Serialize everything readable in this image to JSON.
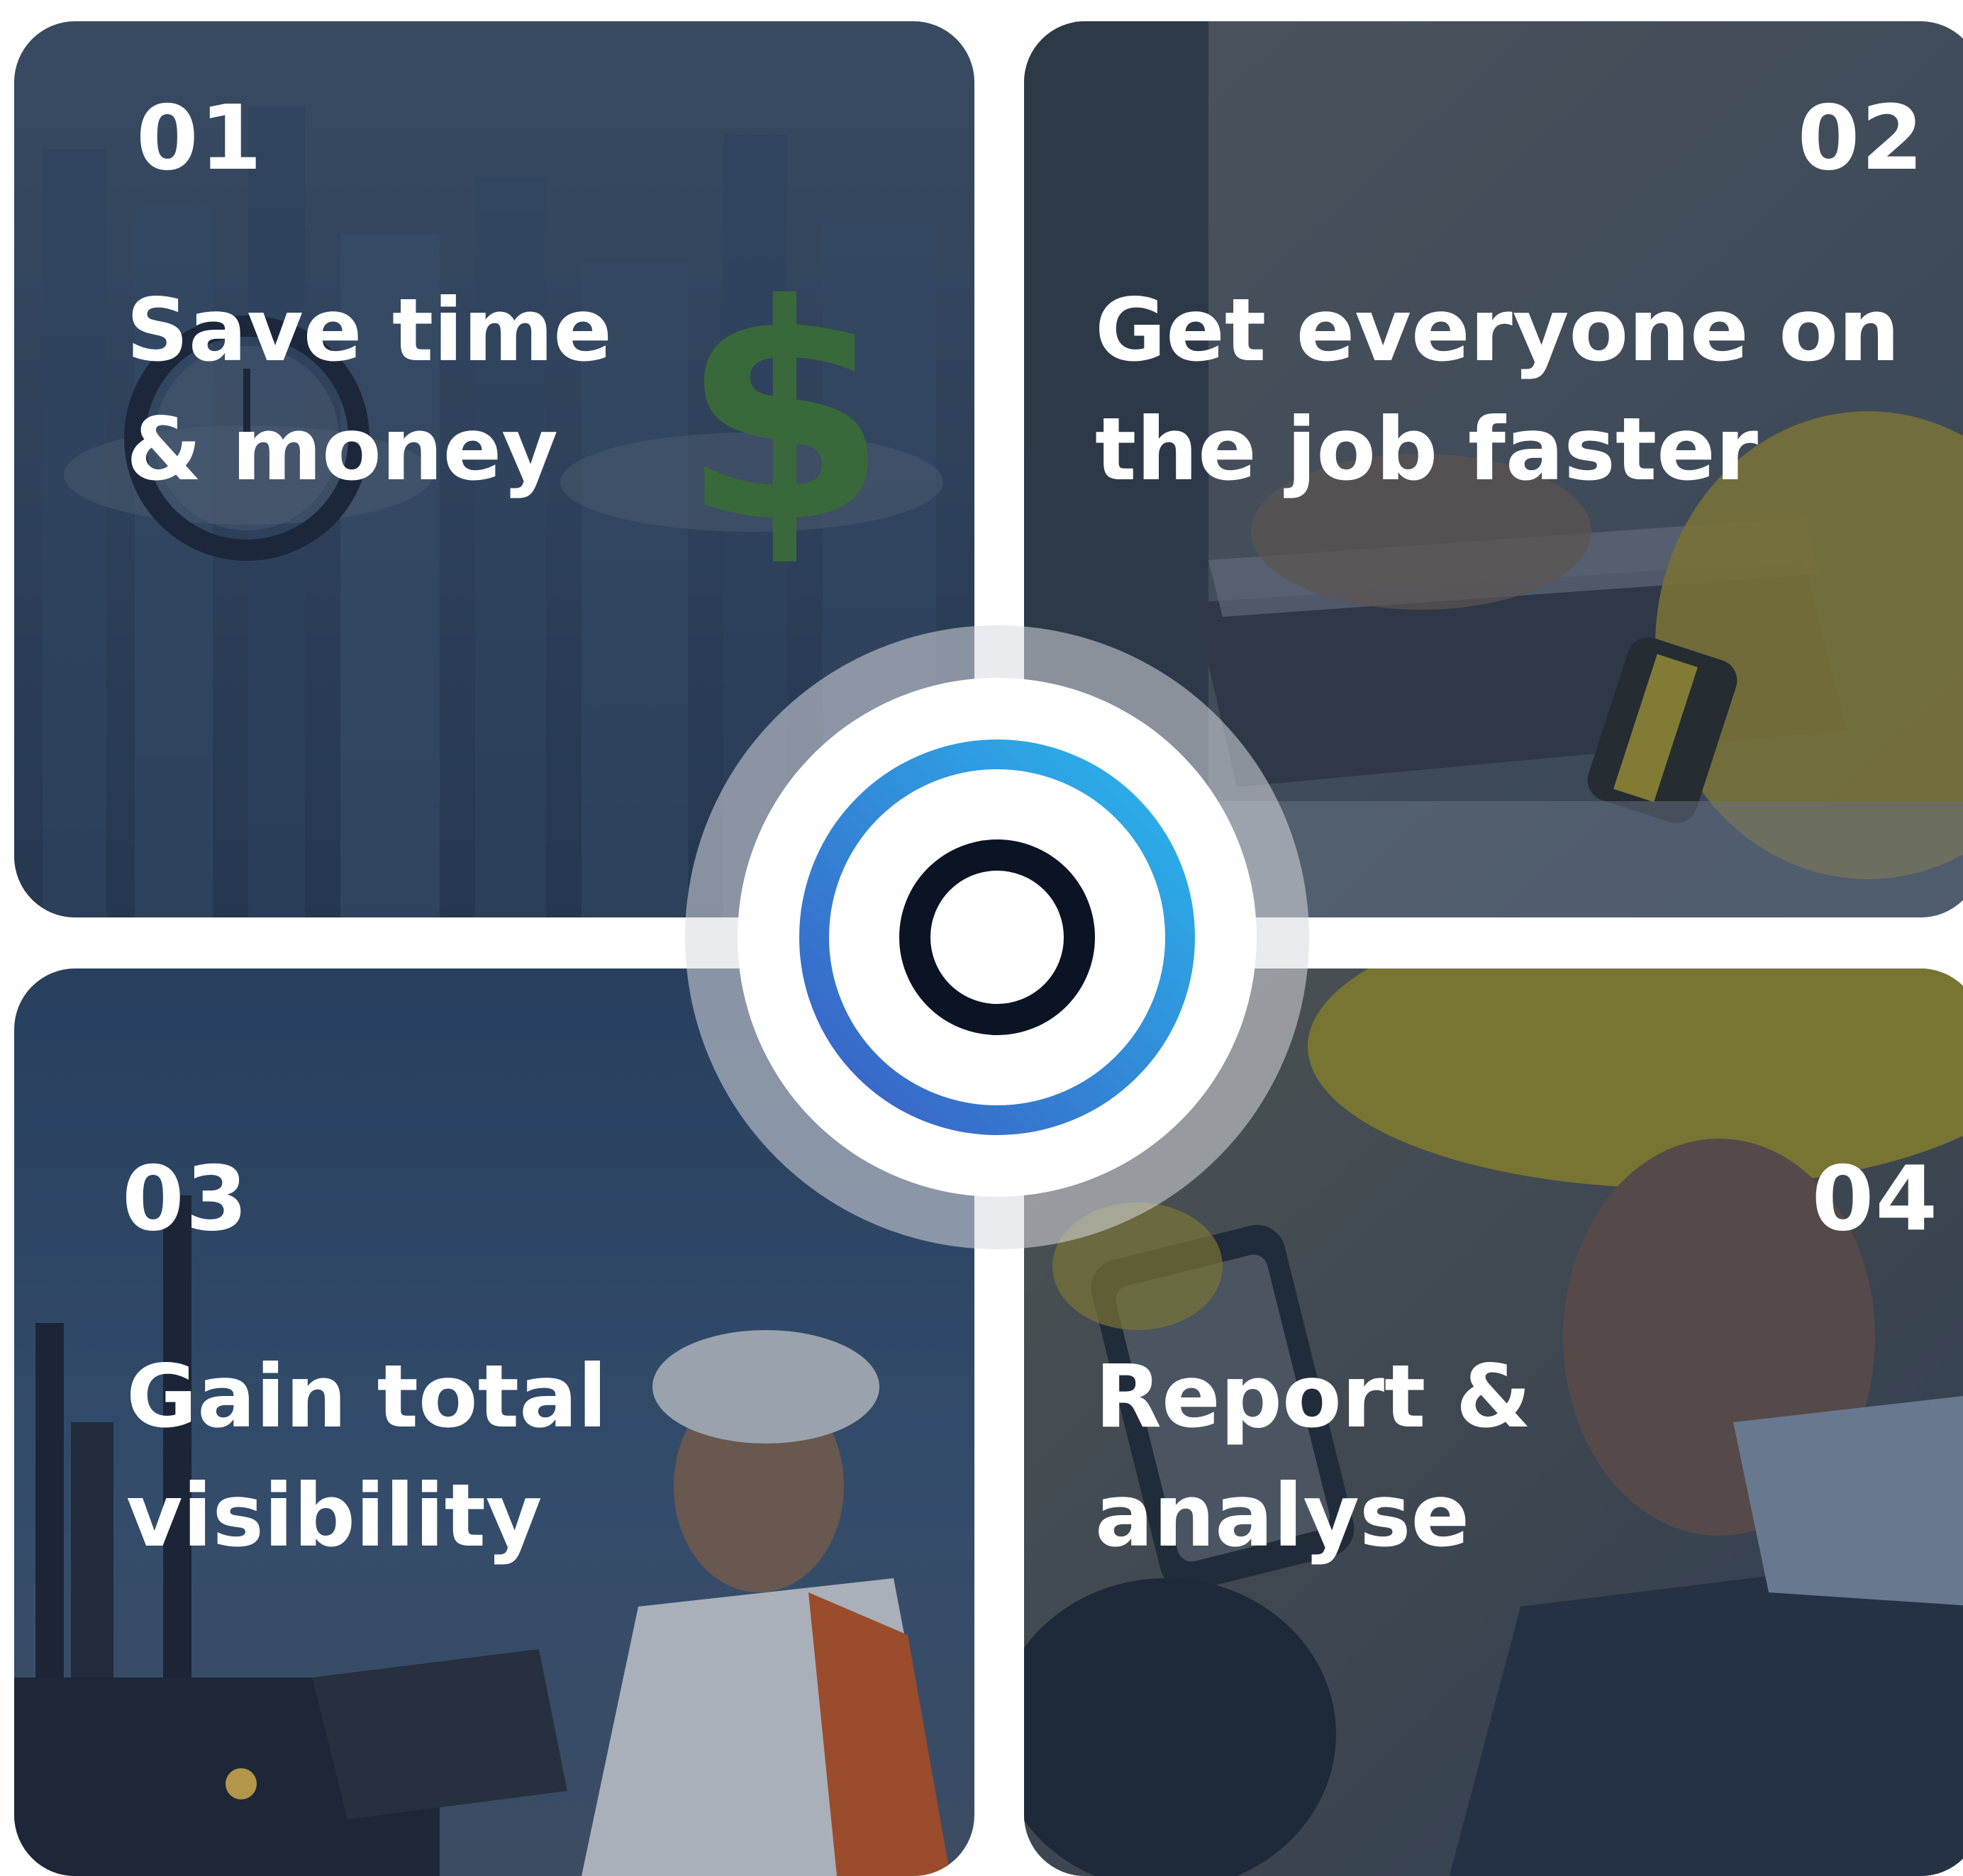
{
  "cards": [
    {
      "number": "01",
      "title": "Save time\n& money"
    },
    {
      "number": "02",
      "title": "Get everyone on\nthe job faster"
    },
    {
      "number": "03",
      "title": "Gain total\nvisibility"
    },
    {
      "number": "04",
      "title": "Report &\nanalyse"
    }
  ],
  "center_logo": {
    "icon": "target-ring-logo-icon",
    "outer_ring_colors": [
      "#3a5fc4",
      "#2ab5ec"
    ],
    "inner_ring_color": "#0b1424"
  },
  "colors": {
    "overlay": "#1e2f4a",
    "text": "#ffffff"
  }
}
